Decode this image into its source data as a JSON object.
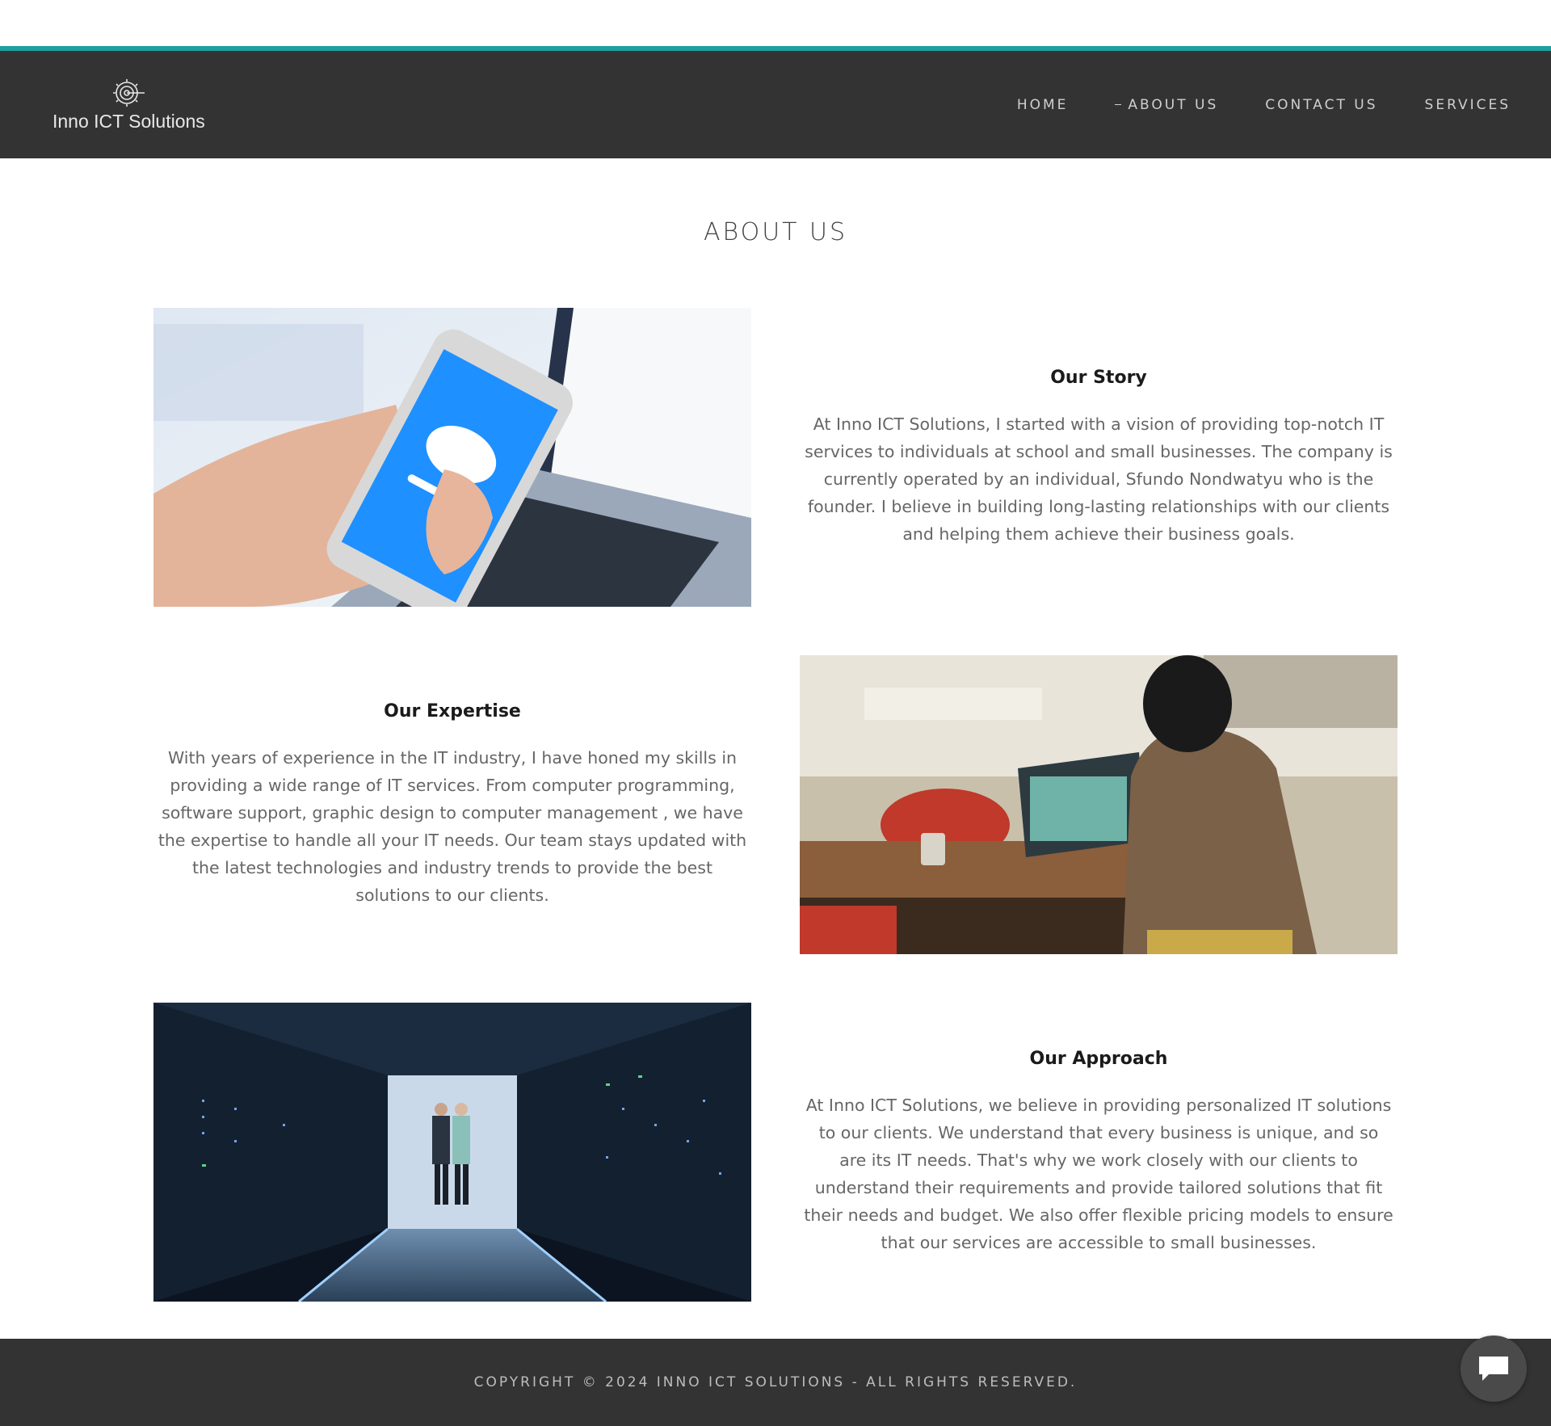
{
  "brand": {
    "name": "Inno ICT Solutions",
    "logo_icon": "gear-target-icon"
  },
  "nav": {
    "items": [
      {
        "label": "HOME"
      },
      {
        "label": "ABOUT US"
      },
      {
        "label": "CONTACT US"
      },
      {
        "label": "SERVICES"
      }
    ]
  },
  "page": {
    "title": "ABOUT US"
  },
  "sections": [
    {
      "heading": "Our Story",
      "body": "At Inno ICT Solutions, I started with a vision of providing top-notch IT services to individuals at school and  small businesses. The company is currently operated by an individual, Sfundo Nondwatyu who is the founder. I believe in building long-lasting relationships with our clients and helping them achieve their business goals.",
      "image": "phone-cloud-upload-photo"
    },
    {
      "heading": "Our Expertise",
      "body": "With years of experience in the IT industry, I have honed my skills in providing a wide range of IT services. From computer programming, software support, graphic design to computer management , we have the expertise to handle all your IT needs. Our team stays updated with the latest technologies and industry trends to provide the best solutions to our clients.",
      "image": "person-at-laptop-photo"
    },
    {
      "heading": "Our Approach",
      "body": "At Inno ICT Solutions, we believe in providing personalized IT solutions to our clients. We understand that every business is unique, and so are its IT needs. That's why we work closely with our clients to understand their requirements and provide tailored solutions that fit their needs and budget. We also offer flexible pricing models to ensure that our services are accessible to small businesses.",
      "image": "data-center-photo"
    }
  ],
  "footer": {
    "copyright": "COPYRIGHT © 2024 INNO ICT SOLUTIONS - ALL RIGHTS RESERVED."
  },
  "chat": {
    "icon": "chat-bubble-icon"
  },
  "colors": {
    "accent": "#1aa0a0",
    "header_bg": "#333333",
    "footer_bg": "#333333"
  }
}
